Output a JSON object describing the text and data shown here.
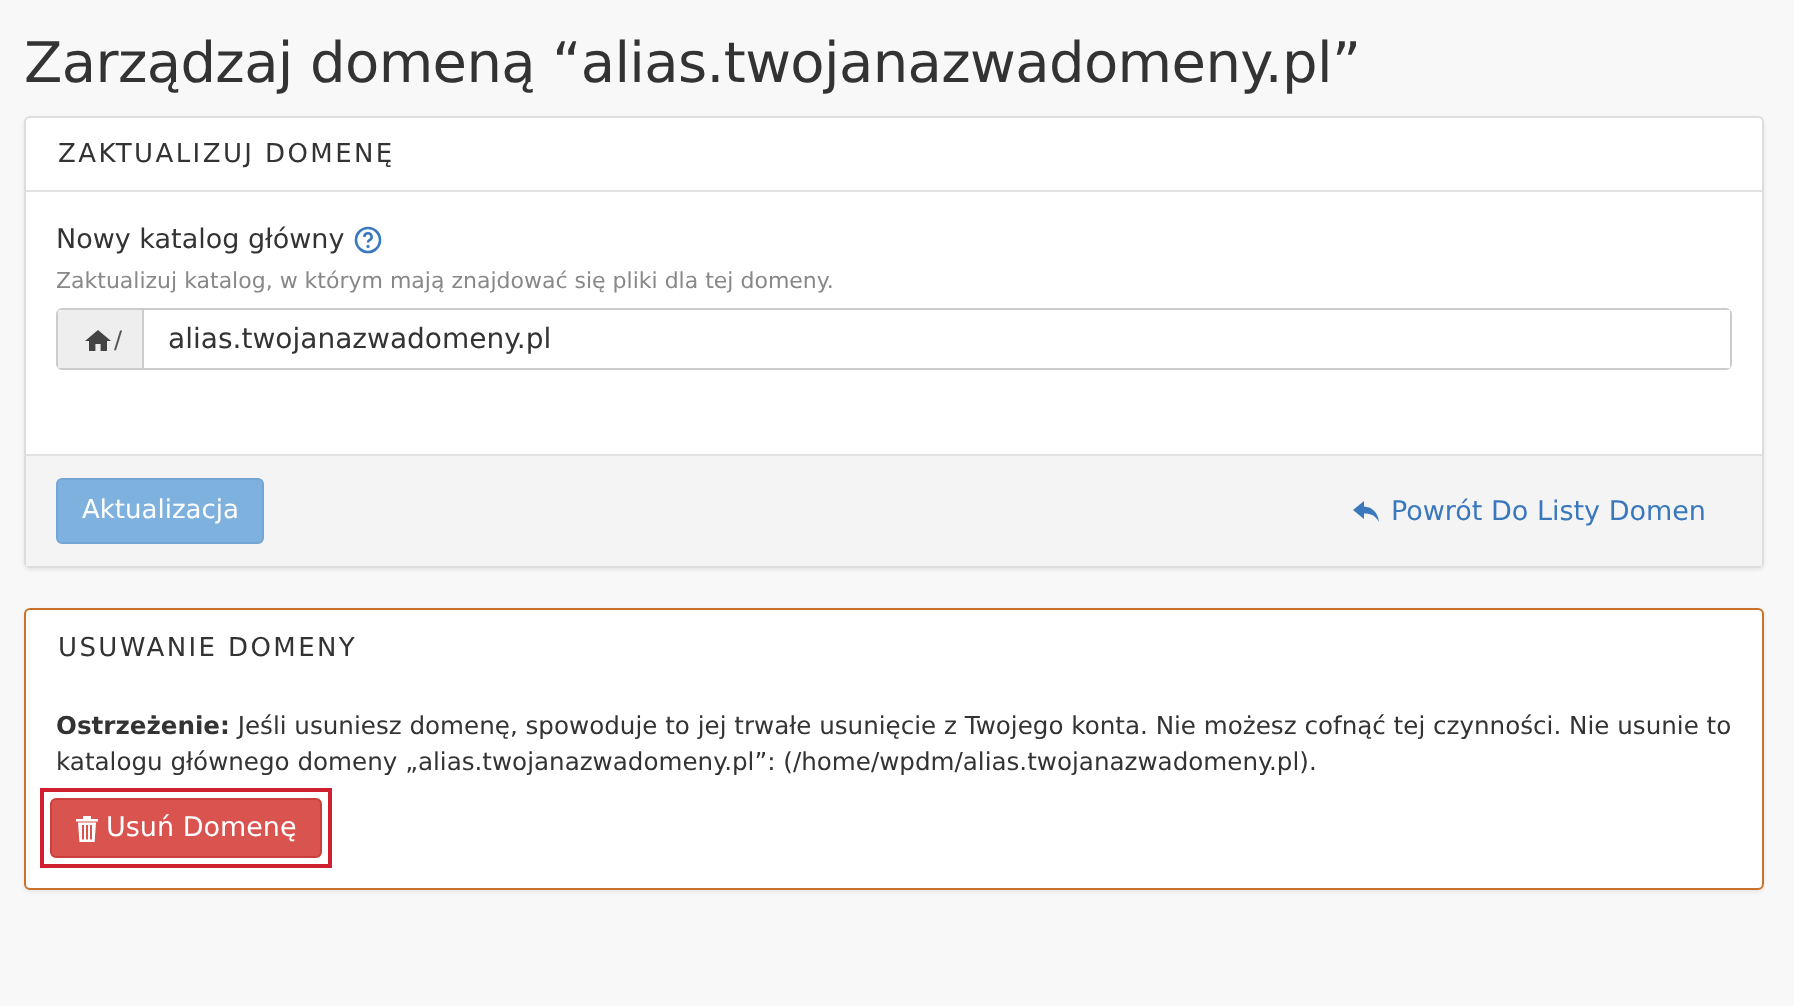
{
  "page_title": "Zarządzaj domeną “alias.twojanazwadomeny.pl”",
  "update_panel": {
    "title": "ZAKTUALIZUJ DOMENĘ",
    "field_label": "Nowy katalog główny",
    "help": "Zaktualizuj katalog, w którym mają znajdować się pliki dla tej domeny.",
    "path_prefix": "/",
    "value": "alias.twojanazwadomeny.pl",
    "submit": {
      "label": "Aktualizacja",
      "disabled": true
    },
    "back_link": "Powrót Do Listy Domen"
  },
  "delete_panel": {
    "title": "USUWANIE DOMENY",
    "warning": "**Ostrzeżenie:** Jeśli usuniesz domenę, spowoduje to jej trwałe usunięcie z Twojego konta. Nie możesz cofnąć tej czynności. Nie usunie to katalogu głównego domeny „alias.twojanazwadomeny.pl”: (/home/wpdm/alias.twojanazwadomeny.pl).",
    "delete_button": {
      "label": "Usuń Domenę",
      "highlighted": true
    }
  }
}
